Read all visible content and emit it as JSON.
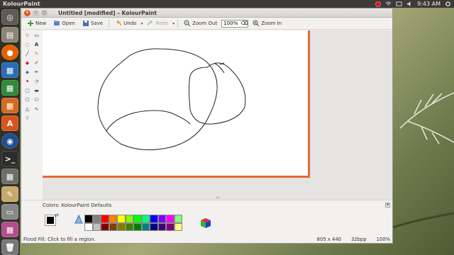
{
  "top_panel": {
    "app_name": "KolourPaint",
    "clock": "9:43 AM"
  },
  "window": {
    "title": "Untitled [modified] – KolourPaint"
  },
  "toolbar": {
    "new_label": "New",
    "open_label": "Open",
    "save_label": "Save",
    "undo_label": "Undo",
    "redo_label": "Redo",
    "zoom_out_label": "Zoom Out",
    "zoom_value": "100%",
    "zoom_in_label": "Zoom In"
  },
  "colors": {
    "label": "Colors: KolourPaint Defaults",
    "foreground": "#000000",
    "palette": [
      "#000000",
      "#808080",
      "#ff0000",
      "#ff8000",
      "#ffff00",
      "#80ff00",
      "#00ff00",
      "#00ff80",
      "#0000ff",
      "#8000ff",
      "#ff00ff",
      "#80ff80",
      "#ffffff",
      "#c0c0c0",
      "#800000",
      "#804000",
      "#808000",
      "#408000",
      "#008000",
      "#008080",
      "#000080",
      "#400080",
      "#800080",
      "#ffff80"
    ]
  },
  "status": {
    "message": "Flood Fill: Click to fill a region.",
    "dimensions": "805 x 440",
    "depth": "32bpp",
    "zoom": "100%"
  },
  "theme": {
    "canvas_border": "#e06c36",
    "close_button": "#e95420"
  }
}
